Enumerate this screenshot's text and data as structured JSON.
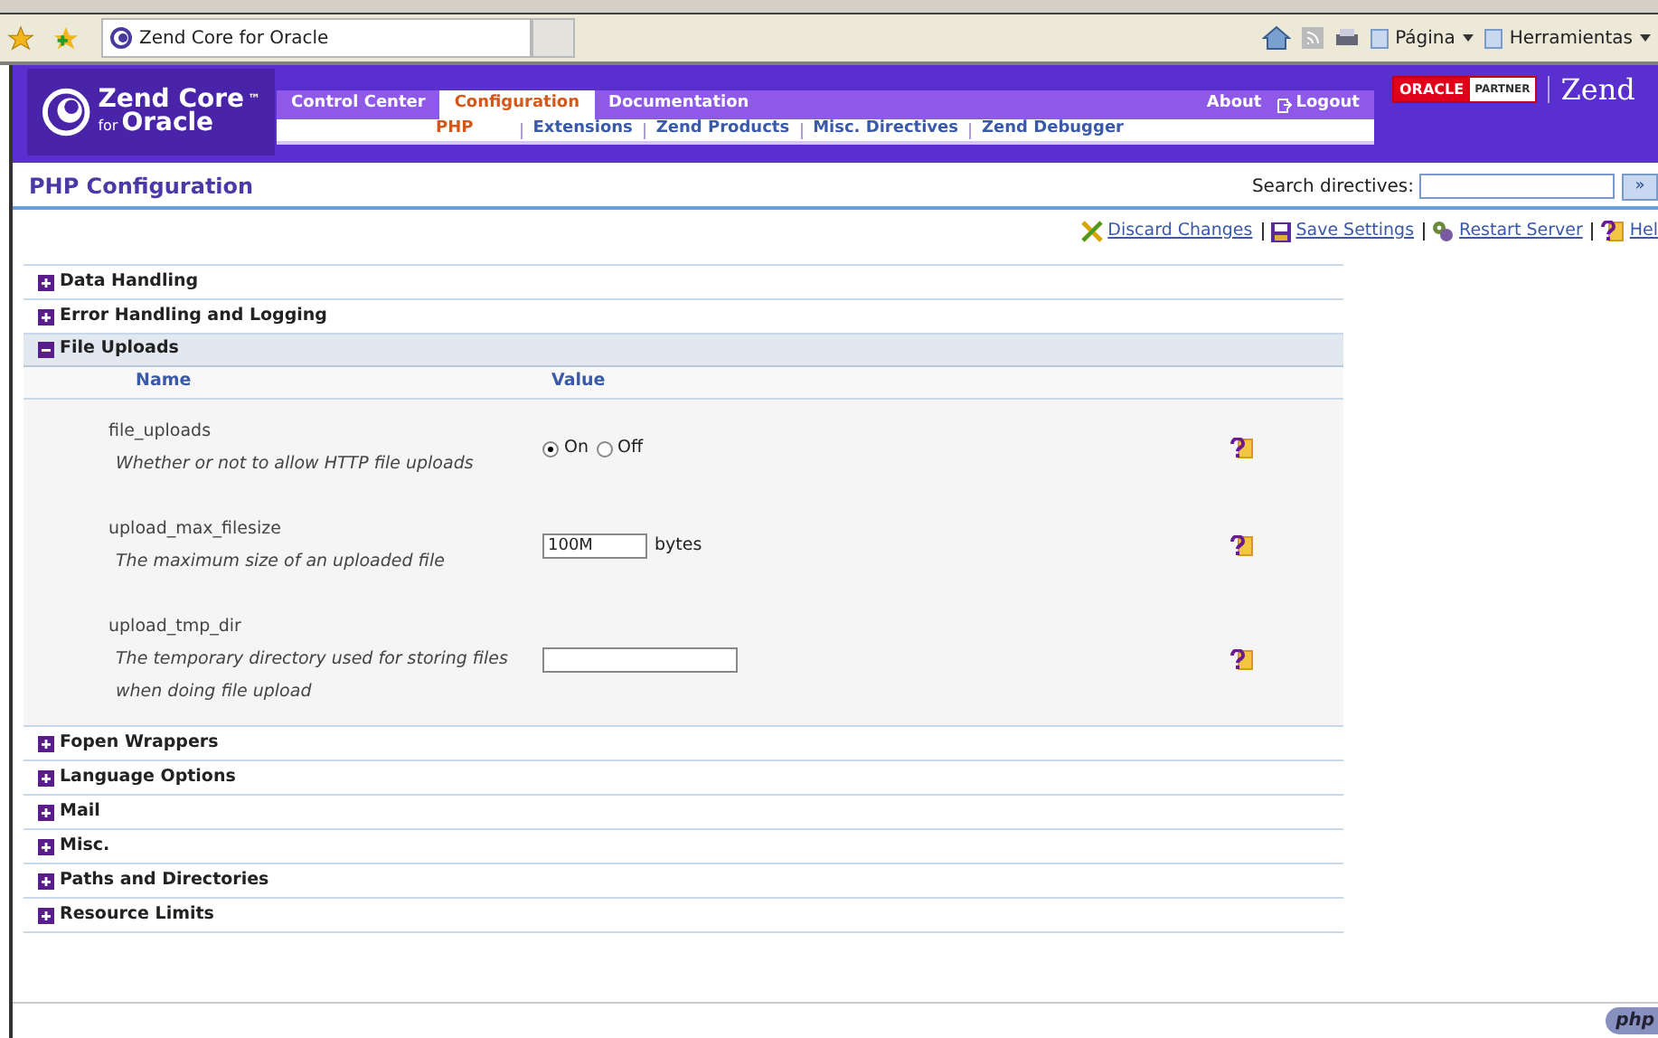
{
  "browser": {
    "tab_title": "Zend Core for Oracle",
    "menu": [
      "Página",
      "Herramientas"
    ]
  },
  "header": {
    "logo_title": "Zend Core",
    "logo_mark": "™",
    "logo_sub_small": "for",
    "logo_sub": "Oracle",
    "main_tabs": [
      {
        "label": "Control Center",
        "selected": false
      },
      {
        "label": "Configuration",
        "selected": true
      },
      {
        "label": "Documentation",
        "selected": false
      }
    ],
    "sub_tabs": [
      {
        "label": "PHP",
        "selected": true
      },
      {
        "label": "Extensions",
        "selected": false
      },
      {
        "label": "Zend Products",
        "selected": false
      },
      {
        "label": "Misc. Directives",
        "selected": false
      },
      {
        "label": "Zend Debugger",
        "selected": false
      }
    ],
    "about": "About",
    "logout": "Logout",
    "partner_brand": "ORACLE",
    "partner_label": "PARTNER",
    "brand": "Zend"
  },
  "page": {
    "title": "PHP Configuration",
    "search": {
      "label": "Search directives:",
      "button": "»"
    },
    "actions": [
      {
        "kind": "discard",
        "label": "Discard Changes"
      },
      {
        "kind": "save",
        "label": "Save Settings"
      },
      {
        "kind": "restart",
        "label": "Restart Server"
      },
      {
        "kind": "help",
        "label": "Hel"
      }
    ]
  },
  "sections": [
    {
      "title": "Data Handling",
      "expanded": false
    },
    {
      "title": "Error Handling and Logging",
      "expanded": false
    },
    {
      "title": "File Uploads",
      "expanded": true,
      "columns": [
        "Name",
        "Value"
      ],
      "settings": [
        {
          "kind": "radio",
          "name": "file_uploads",
          "description": "Whether or not to allow HTTP file uploads",
          "options": [
            {
              "label": "On",
              "selected": true
            },
            {
              "label": "Off",
              "selected": false
            }
          ]
        },
        {
          "kind": "text",
          "name": "upload_max_filesize",
          "description": "The maximum size of an uploaded file",
          "value": "100M",
          "unit": "bytes"
        },
        {
          "kind": "text",
          "name": "upload_tmp_dir",
          "description": "The temporary directory used for storing files when doing file upload"
        }
      ]
    },
    {
      "title": "Fopen Wrappers",
      "expanded": false
    },
    {
      "title": "Language Options",
      "expanded": false
    },
    {
      "title": "Mail",
      "expanded": false
    },
    {
      "title": "Misc.",
      "expanded": false
    },
    {
      "title": "Paths and Directories",
      "expanded": false
    },
    {
      "title": "Resource Limits",
      "expanded": false
    }
  ],
  "footer": {
    "logo": "php"
  }
}
